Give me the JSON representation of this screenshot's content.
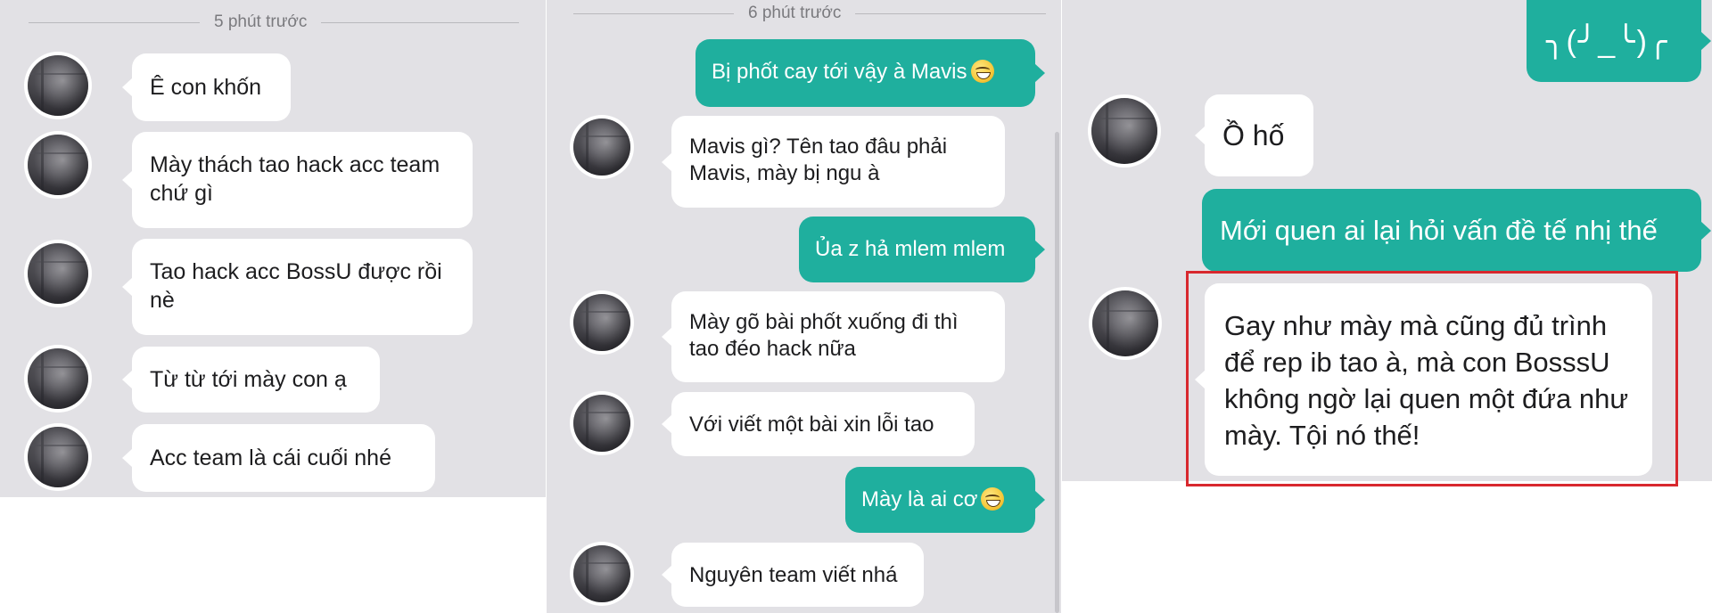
{
  "panel1": {
    "timestamp": "5 phút trước",
    "messages": [
      {
        "text": "Ê con khốn"
      },
      {
        "text": "Mày thách tao hack acc team chứ gì"
      },
      {
        "text": "Tao hack acc BossU được rồi nè"
      },
      {
        "text": "Từ từ tới mày con ạ"
      },
      {
        "text": "Acc team là cái cuối nhé"
      }
    ]
  },
  "panel2": {
    "timestamp": "6 phút trước",
    "messages": [
      {
        "direction": "out",
        "text": "Bị phốt cay tới vậy à Mavis",
        "emoji": "grinning-face"
      },
      {
        "direction": "in",
        "text": "Mavis gì? Tên tao đâu phải Mavis, mày bị ngu à"
      },
      {
        "direction": "out",
        "text": "Ủa z hả mlem mlem"
      },
      {
        "direction": "in",
        "text": "Mày gõ bài phốt xuống đi thì tao đéo hack nữa"
      },
      {
        "direction": "in",
        "text": "Với viết một bài xin lỗi tao"
      },
      {
        "direction": "out",
        "text": "Mày là ai cơ",
        "emoji": "grinning-face"
      },
      {
        "direction": "in",
        "text": "Nguyên team viết nhá"
      }
    ]
  },
  "panel3": {
    "messages": [
      {
        "direction": "out",
        "text": "╮(╯_╰)╭"
      },
      {
        "direction": "in",
        "text": "Ồ hố"
      },
      {
        "direction": "out",
        "text": "Mới quen ai lại hỏi vấn đề tế nhị thế"
      },
      {
        "direction": "in",
        "text": "Gay như mày mà cũng đủ trình để rep ib tao à, mà con BosssU không ngờ lại quen một đứa như mày. Tội nó thế!",
        "highlighted": true
      }
    ]
  },
  "colors": {
    "background": "#e2e1e5",
    "outgoing_bubble": "#1faf9e",
    "incoming_bubble": "#ffffff",
    "highlight_border": "#d8282e"
  }
}
